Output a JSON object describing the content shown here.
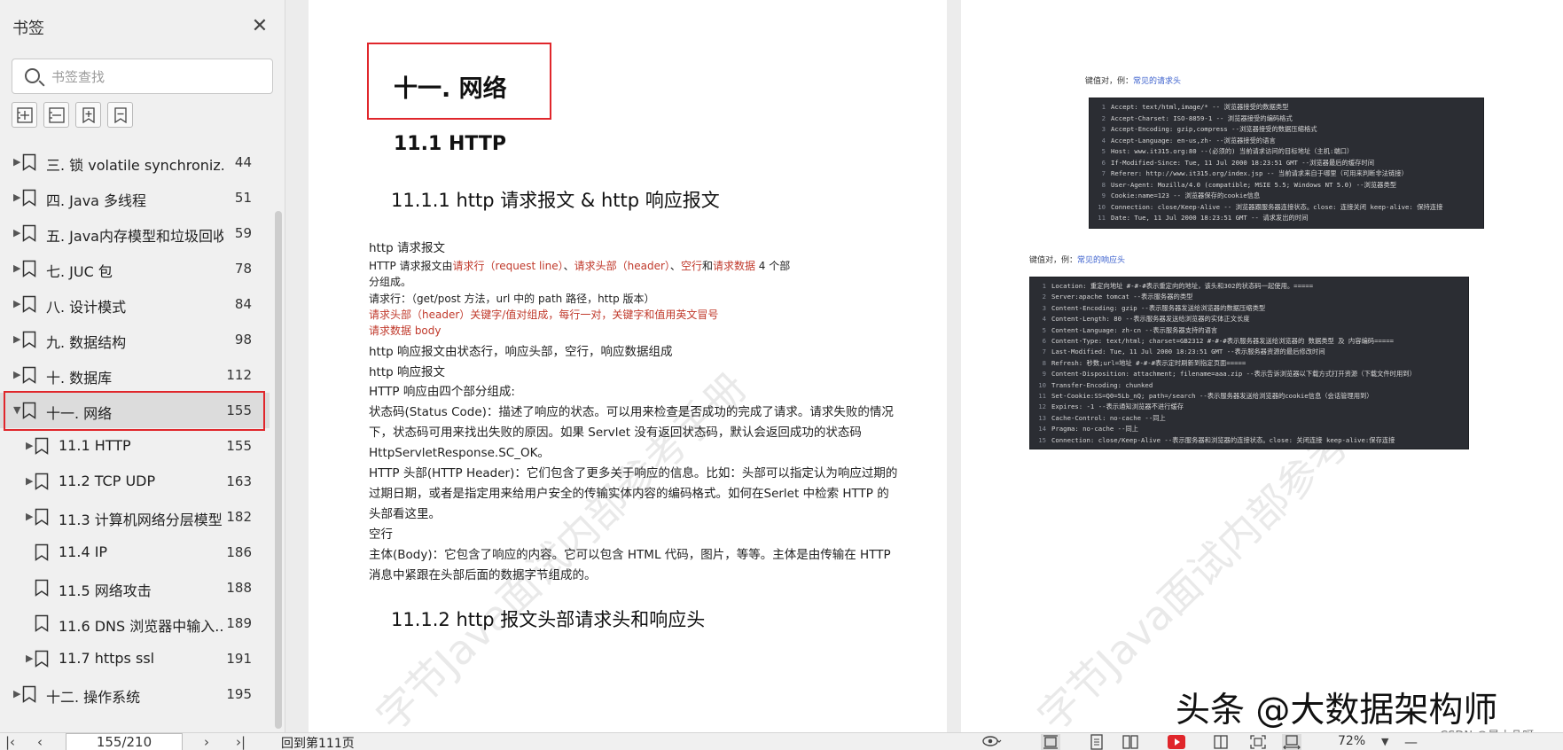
{
  "sidebar": {
    "title": "书签",
    "search_placeholder": "书签查找",
    "items": [
      {
        "label": "三. 锁 volatile synchroniz...",
        "page": "44",
        "level": 0,
        "caret": "▶"
      },
      {
        "label": "四. Java 多线程",
        "page": "51",
        "level": 0,
        "caret": "▶"
      },
      {
        "label": "五. Java内存模型和垃圾回收",
        "page": "59",
        "level": 0,
        "caret": "▶"
      },
      {
        "label": "七. JUC 包",
        "page": "78",
        "level": 0,
        "caret": "▶"
      },
      {
        "label": "八. 设计模式",
        "page": "84",
        "level": 0,
        "caret": "▶"
      },
      {
        "label": "九. 数据结构",
        "page": "98",
        "level": 0,
        "caret": "▶"
      },
      {
        "label": "十. 数据库",
        "page": "112",
        "level": 0,
        "caret": "▶"
      },
      {
        "label": "十一. 网络",
        "page": "155",
        "level": 0,
        "caret": "▼",
        "selected": true
      },
      {
        "label": "11.1 HTTP",
        "page": "155",
        "level": 1,
        "caret": "▶"
      },
      {
        "label": "11.2 TCP UDP",
        "page": "163",
        "level": 1,
        "caret": "▶"
      },
      {
        "label": "11.3 计算机网络分层模型",
        "page": "182",
        "level": 1,
        "caret": "▶"
      },
      {
        "label": "11.4 IP",
        "page": "186",
        "level": 1,
        "caret": ""
      },
      {
        "label": "11.5 网络攻击",
        "page": "188",
        "level": 1,
        "caret": ""
      },
      {
        "label": "11.6 DNS 浏览器中输入...",
        "page": "189",
        "level": 1,
        "caret": ""
      },
      {
        "label": "11.7 https ssl",
        "page": "191",
        "level": 1,
        "caret": "▶"
      },
      {
        "label": "十二. 操作系统",
        "page": "195",
        "level": 0,
        "caret": "▶"
      }
    ]
  },
  "left_page": {
    "h1": "十一. 网络",
    "h2": "11.1 HTTP",
    "h3a": "11.1.1 http 请求报文 & http 响应报文",
    "h3b": "11.1.2 http 报文头部请求头和响应头",
    "watermark": "字节Java面试内部参考手册",
    "body": {
      "l1": "http 请求报文",
      "l2a": "HTTP 请求报文由",
      "l2b": "请求行（request line）",
      "l2c": "、",
      "l2d": "请求头部（header）",
      "l2e": "、",
      "l2f": "空行",
      "l2g": "和",
      "l2h": "请求数据",
      "l2i": " 4 个部",
      "l3": "分组成。",
      "l4": "请求行：（get/post 方法，url 中的 path 路径，http 版本）",
      "l5": "请求头部（header）关键字/值对组成，每行一对，关键字和值用英文冒号",
      "l6": "请求数据  body",
      "l7": "http 响应报文由状态行，响应头部，空行，响应数据组成",
      "l8": "http 响应报文",
      "l9": "HTTP 响应由四个部分组成:",
      "l10": "状态码(Status Code)：描述了响应的状态。可以用来检查是否成功的完成了请求。请求失败的情况",
      "l11": "下，状态码可用来找出失败的原因。如果 Servlet 没有返回状态码，默认会返回成功的状态码",
      "l12": "HttpServletResponse.SC_OK。",
      "l13": "HTTP 头部(HTTP Header)：它们包含了更多关于响应的信息。比如：头部可以指定认为响应过期的",
      "l14": "过期日期，或者是指定用来给用户安全的传输实体内容的编码格式。如何在Serlet 中检索 HTTP 的",
      "l15": "头部看这里。",
      "l16": "空行",
      "l17": "主体(Body)：它包含了响应的内容。它可以包含 HTML 代码，图片，等等。主体是由传输在 HTTP",
      "l18": "消息中紧跟在头部后面的数据字节组成的。"
    }
  },
  "right_page": {
    "watermark": "字节Java面试内部参考手册",
    "caption1_prefix": "键值对，例：",
    "caption1_link": "常见的请求头",
    "caption2_prefix": "键值对，例：",
    "caption2_link": "常见的响应头",
    "code1": [
      "Accept: text/html,image/*          -- 浏览器接受的数据类型",
      "Accept-Charset: ISO-8859-1         -- 浏览器接受的编码格式",
      "Accept-Encoding: gzip,compress            --浏览器接受的数据压缩格式",
      "Accept-Language: en-us,zh-          --浏览器接受的语言",
      "Host: www.it315.org:80          --(必须的) 当前请求访问的目标地址（主机:端口）",
      "If-Modified-Since: Tue, 11 Jul 2000 18:23:51 GMT          --浏览器最后的缓存时间",
      "Referer: http://www.it315.org/index.jsp          -- 当前请求来自于哪里（可用来判断非法链接）",
      "User-Agent: Mozilla/4.0 (compatible; MSIE 5.5; Windows NT 5.0)          --浏览器类型",
      "Cookie:name=123          -- 浏览器保存的cookie信息",
      "Connection: close/Keep-Alive          -- 浏览器跟服务器连接状态。close: 连接关闭  keep-alive: 保持连接",
      "Date: Tue, 11 Jul 2000 18:23:51 GMT          -- 请求发出的时间"
    ],
    "code2": [
      "Location: 重定向地址     #-#-#表示重定向的地址，该头和302的状态码一起使用。=====",
      "Server:apache tomcat          --表示服务器的类型",
      "Content-Encoding: gzip          --表示服务器发送给浏览器的数据压缩类型",
      "Content-Length: 80          --表示服务器发送给浏览器的实体正文长度",
      "Content-Language: zh-cn          --表示服务器支持的语言",
      "Content-Type: text/html; charset=GB2312     #-#-#表示服务器发送给浏览器的 数据类型 及 内容编码=====",
      "Last-Modified: Tue, 11 Jul 2000 18:23:51 GMT          --表示服务器资源的最后修改时间",
      "Refresh: 秒数;url=地址     #-#-#表示定时刷新到指定页面=====",
      "Content-Disposition: attachment; filename=aaa.zip          --表示告诉浏览器以下载方式打开资源（下载文件时用到）",
      "Transfer-Encoding: chunked",
      "Set-Cookie:SS=Q0=5Lb_nQ; path=/search          --表示服务器发送给浏览器的cookie信息（会话管理用到）",
      "Expires: -1          --表示通知浏览器不进行缓存",
      "Cache-Control: no-cache     --同上",
      "Pragma: no-cache     --同上",
      "Connection: close/Keep-Alive          --表示服务器和浏览器的连接状态。close: 关闭连接  keep-alive:保存连接"
    ]
  },
  "overlay": {
    "toutiao": "头条 @大数据架构师",
    "csdn": "CSDN @是小凡呀"
  },
  "bottombar": {
    "page_value": "155/210",
    "back_text": "回到第111页",
    "zoom": "72%",
    "colors": {
      "accent": "#e0262b"
    }
  }
}
